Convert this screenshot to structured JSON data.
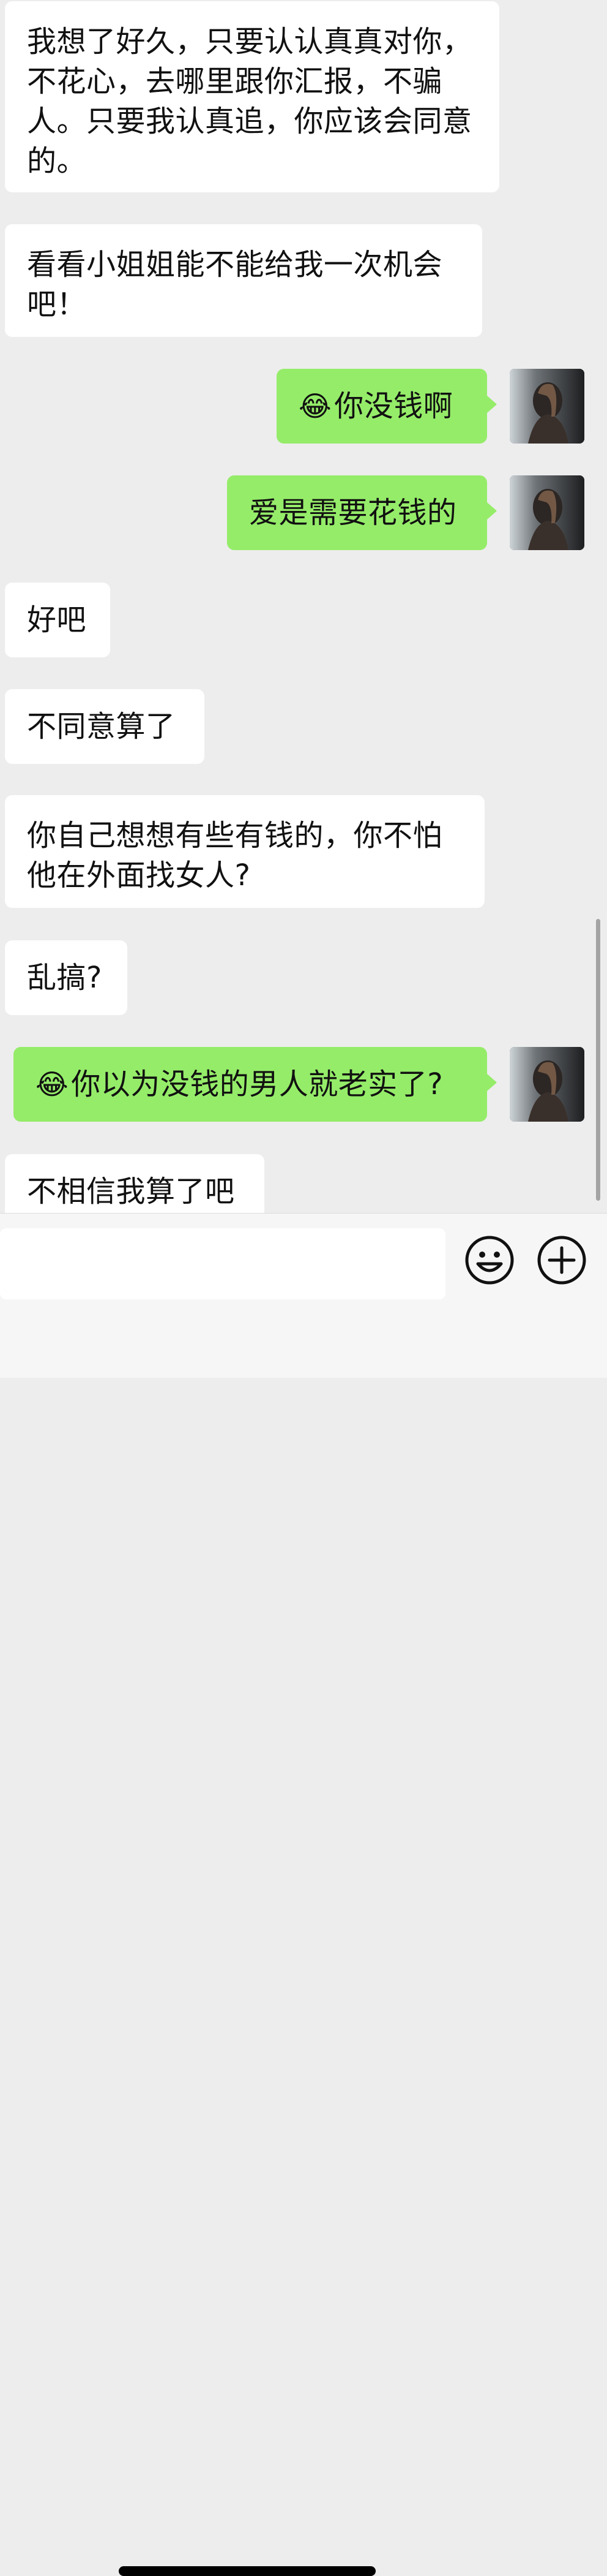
{
  "messages": [
    {
      "side": "in",
      "text": "我想了好久，只要认认真真对你，不花心，去哪里跟你汇报，不骗人。只要我认真追，你应该会同意的。"
    },
    {
      "side": "in",
      "text": "看看小姐姐能不能给我一次机会吧！"
    },
    {
      "side": "out",
      "emoji": "😂",
      "text": "你没钱啊"
    },
    {
      "side": "out",
      "text": "爱是需要花钱的"
    },
    {
      "side": "in",
      "text": "好吧"
    },
    {
      "side": "in",
      "text": "不同意算了"
    },
    {
      "side": "in",
      "text": "你自己想想有些有钱的，你不怕他在外面找女人?"
    },
    {
      "side": "in",
      "text": "乱搞?"
    },
    {
      "side": "out",
      "emoji": "😂",
      "text": "你以为没钱的男人就老实了?"
    },
    {
      "side": "in",
      "text": "不相信我算了吧"
    }
  ],
  "input_bar": {
    "placeholder": "",
    "icons": [
      "emoji-icon",
      "plus-icon"
    ]
  },
  "colors": {
    "background": "#ededed",
    "incoming_bubble": "#ffffff",
    "outgoing_bubble": "#95ec69"
  }
}
